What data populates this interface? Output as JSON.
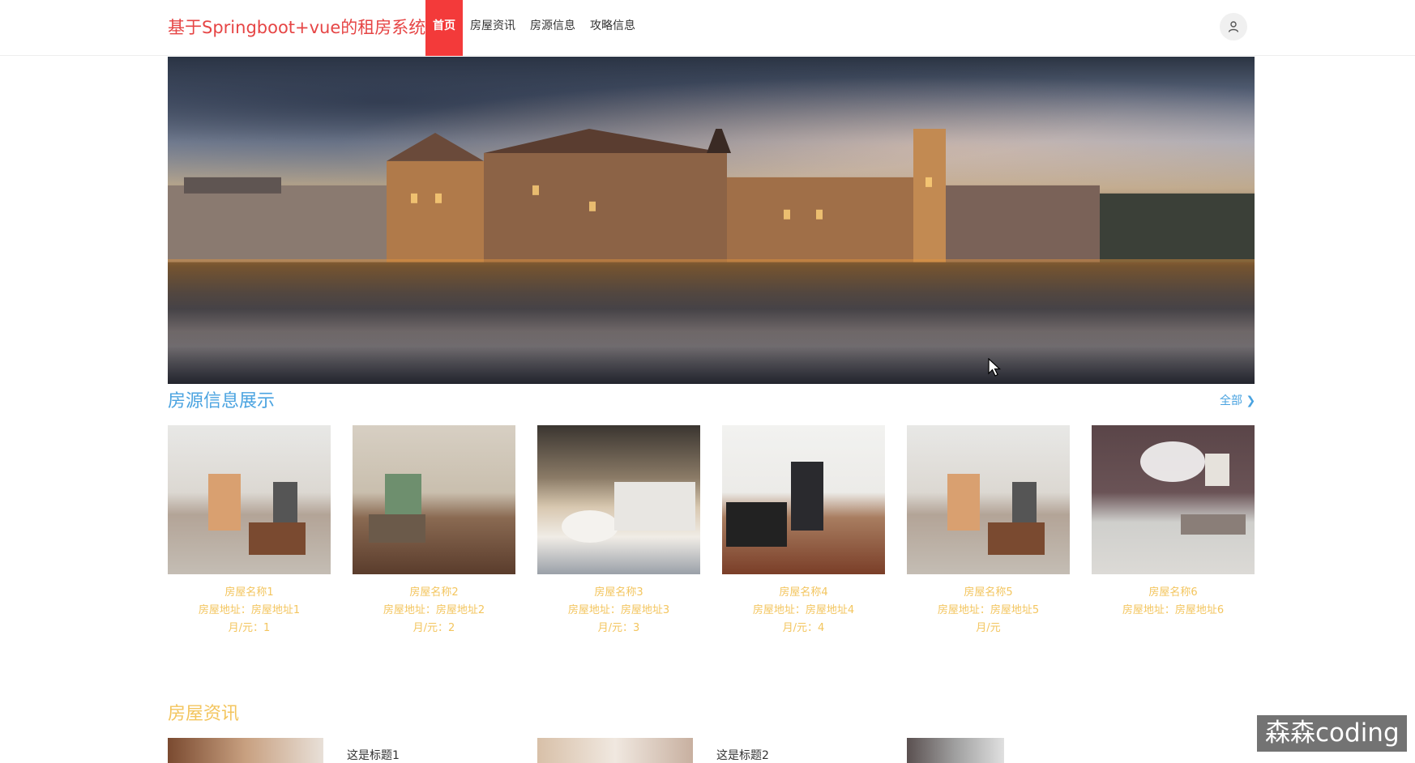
{
  "header": {
    "brand": "基于Springboot+vue的租房系统",
    "nav": [
      "首页",
      "房屋资讯",
      "房源信息",
      "攻略信息"
    ]
  },
  "house_section": {
    "title": "房源信息展示",
    "view_all": "全部 ❯",
    "cards": [
      {
        "name": "房屋名称1",
        "address": "房屋地址：房屋地址1",
        "price": "月/元：1"
      },
      {
        "name": "房屋名称2",
        "address": "房屋地址：房屋地址2",
        "price": "月/元：2"
      },
      {
        "name": "房屋名称3",
        "address": "房屋地址：房屋地址3",
        "price": "月/元：3"
      },
      {
        "name": "房屋名称4",
        "address": "房屋地址：房屋地址4",
        "price": "月/元：4"
      },
      {
        "name": "房屋名称5",
        "address": "房屋地址：房屋地址5",
        "price": "月/元"
      },
      {
        "name": "房屋名称6",
        "address": "房屋地址：房屋地址6",
        "price": ""
      }
    ]
  },
  "news_section": {
    "title": "房屋资讯",
    "items": [
      {
        "title": "这是标题1"
      },
      {
        "title": "这是标题2"
      }
    ]
  },
  "watermark": "森森coding",
  "colors": {
    "brand": "#e64545",
    "nav_active_bg": "#f33a3a",
    "house_title": "#4aa3e0",
    "card_text": "#f3c55e"
  },
  "icons": {
    "avatar": "user-icon",
    "view_all": "chevron-right-icon",
    "cursor": "mouse-pointer-icon"
  }
}
